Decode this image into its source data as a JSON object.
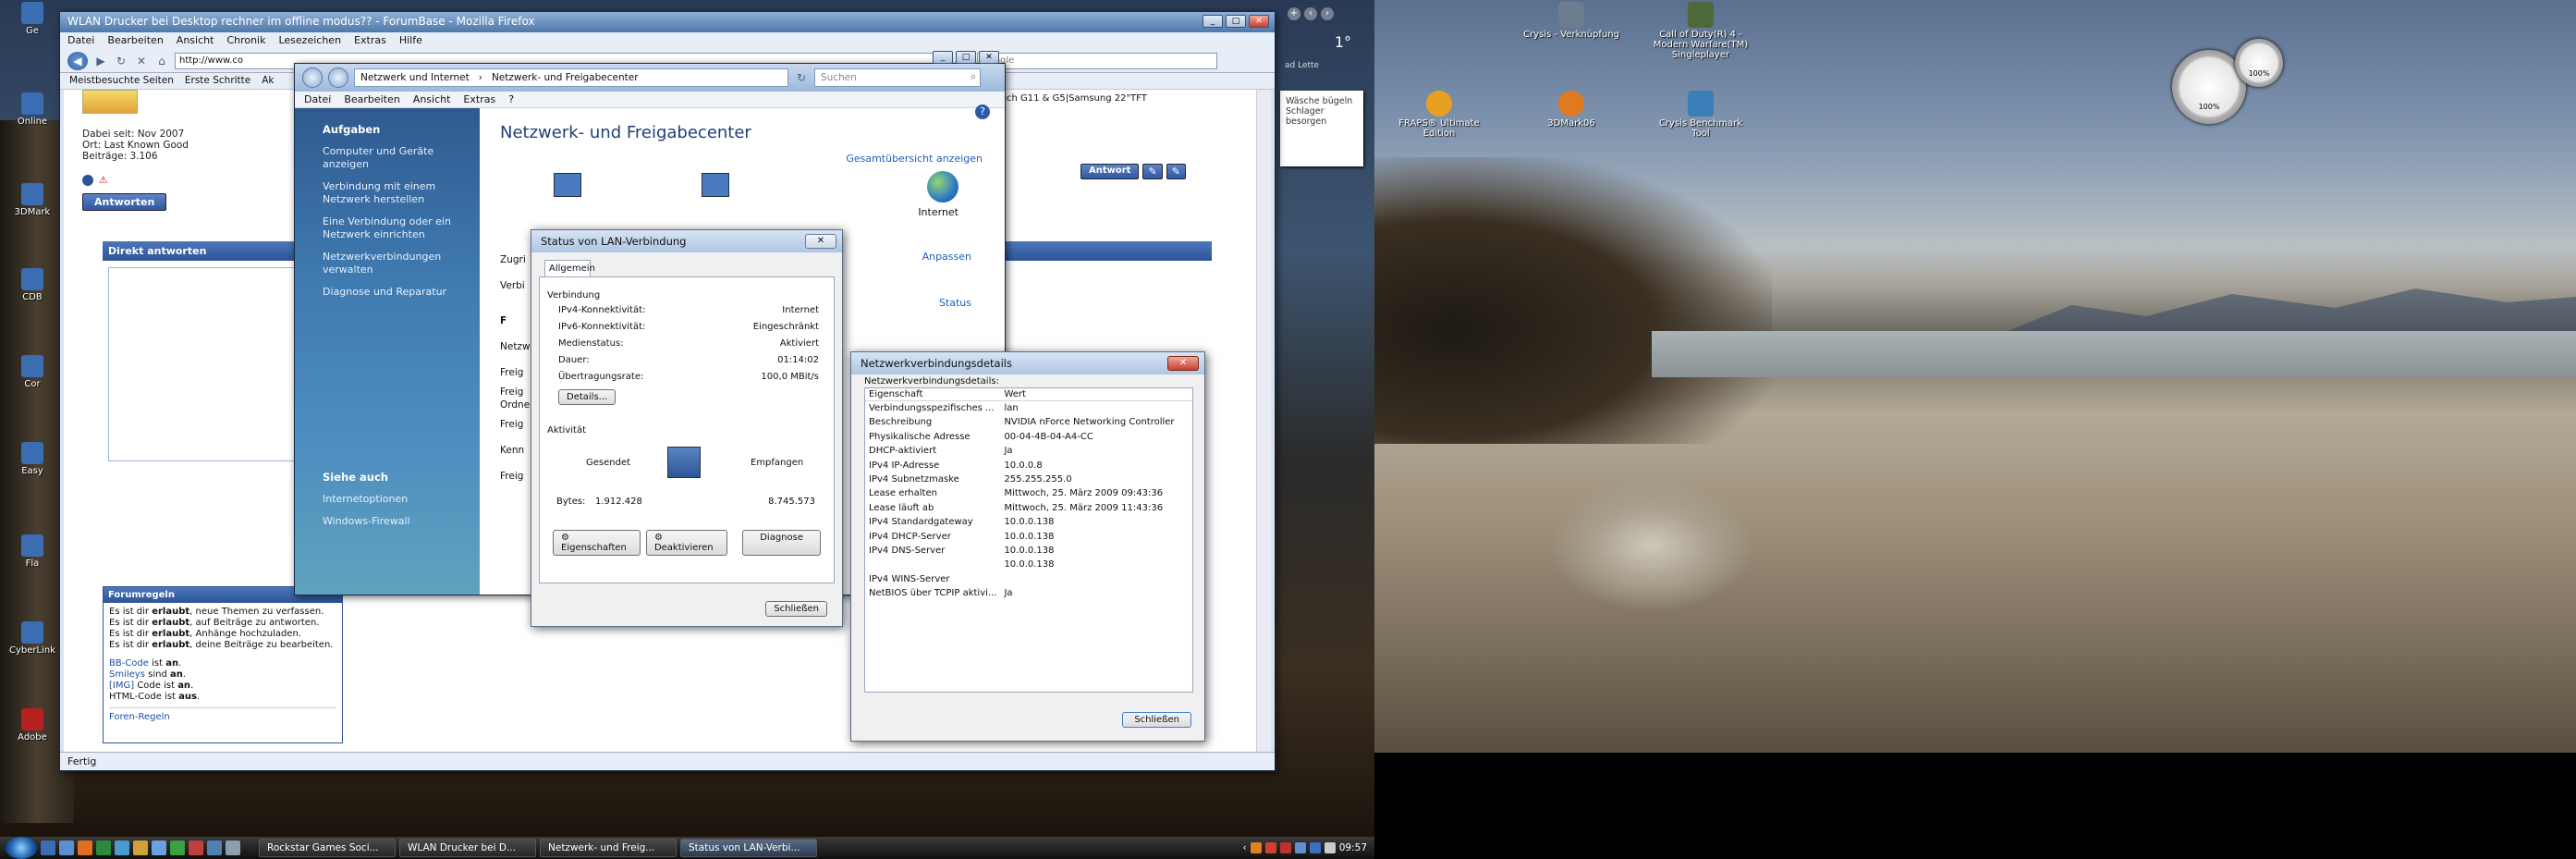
{
  "firefox": {
    "title": "WLAN Drucker bei Desktop rechner im offline modus?? - ForumBase - Mozilla Firefox",
    "menu": [
      "Datei",
      "Bearbeiten",
      "Ansicht",
      "Chronik",
      "Lesezeichen",
      "Extras",
      "Hilfe"
    ],
    "url": "http://www.co",
    "search_placeholder": "Google",
    "bookmarks": [
      "Meistbesuchte Seiten",
      "Erste Schritte",
      "Ak"
    ],
    "status": "Fertig",
    "forum": {
      "user_info": [
        "Dabei seit: Nov 2007",
        "Ort: Last Known Good",
        "Beiträge: 3.106"
      ],
      "answer_button": "Antworten",
      "reply_header": "Direkt antworten",
      "top_right_text": "em|Logitech G11 & G5|Samsung 22\"TFT",
      "answer_button2": "Antwort",
      "rules_header": "Forumregeln",
      "rules": [
        {
          "pre": "Es ist dir ",
          "bold": "erlaubt",
          "post": ", neue Themen zu verfassen."
        },
        {
          "pre": "Es ist dir ",
          "bold": "erlaubt",
          "post": ", auf Beiträge zu antworten."
        },
        {
          "pre": "Es ist dir ",
          "bold": "erlaubt",
          "post": ", Anhänge hochzuladen."
        },
        {
          "pre": "Es ist dir ",
          "bold": "erlaubt",
          "post": ", deine Beiträge zu bearbeiten."
        }
      ],
      "codes": [
        {
          "link": "BB-Code",
          "text": " ist ",
          "val": "an"
        },
        {
          "link": "Smileys",
          "text": " sind ",
          "val": "an"
        },
        {
          "link": "[IMG]",
          "text": " Code ist ",
          "val": "an"
        },
        {
          "link": "",
          "text": "HTML-Code ist ",
          "val": "aus"
        }
      ],
      "rules_link": "Foren-Regeln"
    }
  },
  "control_panel": {
    "address": [
      "Netzwerk und Internet",
      "Netzwerk- und Freigabecenter"
    ],
    "search_placeholder": "Suchen",
    "menu": [
      "Datei",
      "Bearbeiten",
      "Ansicht",
      "Extras",
      "?"
    ],
    "tasks_header": "Aufgaben",
    "tasks": [
      "Computer und Geräte anzeigen",
      "Verbindung mit einem Netzwerk herstellen",
      "Eine Verbindung oder ein Netzwerk einrichten",
      "Netzwerkverbindungen verwalten",
      "Diagnose und Reparatur"
    ],
    "see_also_header": "Siehe auch",
    "see_also": [
      "Internetoptionen",
      "Windows-Firewall"
    ],
    "title": "Netzwerk- und Freigabecenter",
    "overview_link": "Gesamtübersicht anzeigen",
    "internet_label": "Internet",
    "customize_link": "Anpassen",
    "status_link": "Status",
    "partial_labels": [
      "Zugri",
      "Verbi",
      "F",
      "Netzw",
      "Freig",
      "Freig",
      "Ordne",
      "Freig",
      "Kenn",
      "Freig"
    ]
  },
  "lan_status": {
    "title": "Status von LAN-Verbindung",
    "tab": "Allgemein",
    "connection_group": "Verbindung",
    "rows": [
      {
        "k": "IPv4-Konnektivität:",
        "v": "Internet"
      },
      {
        "k": "IPv6-Konnektivität:",
        "v": "Eingeschränkt"
      },
      {
        "k": "Medienstatus:",
        "v": "Aktiviert"
      },
      {
        "k": "Dauer:",
        "v": "01:14:02"
      },
      {
        "k": "Übertragungsrate:",
        "v": "100,0 MBit/s"
      }
    ],
    "details_button": "Details...",
    "activity_group": "Aktivität",
    "sent_label": "Gesendet",
    "received_label": "Empfangen",
    "bytes_label": "Bytes:",
    "bytes_sent": "1.912.428",
    "bytes_received": "8.745.573",
    "buttons": [
      "Eigenschaften",
      "Deaktivieren",
      "Diagnose"
    ],
    "close_button": "Schließen"
  },
  "details": {
    "title": "Netzwerkverbindungsdetails",
    "subtitle": "Netzwerkverbindungsdetails:",
    "col_property": "Eigenschaft",
    "col_value": "Wert",
    "rows": [
      {
        "k": "Verbindungsspezifisches ...",
        "v": "lan"
      },
      {
        "k": "Beschreibung",
        "v": "NVIDIA nForce Networking Controller"
      },
      {
        "k": "Physikalische Adresse",
        "v": "00-04-4B-04-A4-CC"
      },
      {
        "k": "DHCP-aktiviert",
        "v": "Ja"
      },
      {
        "k": "IPv4 IP-Adresse",
        "v": "10.0.0.8"
      },
      {
        "k": "IPv4 Subnetzmaske",
        "v": "255.255.255.0"
      },
      {
        "k": "Lease erhalten",
        "v": "Mittwoch, 25. März 2009 09:43:36"
      },
      {
        "k": "Lease läuft ab",
        "v": "Mittwoch, 25. März 2009 11:43:36"
      },
      {
        "k": "IPv4 Standardgateway",
        "v": "10.0.0.138"
      },
      {
        "k": "IPv4 DHCP-Server",
        "v": "10.0.0.138"
      },
      {
        "k": "IPv4 DNS-Server",
        "v": "10.0.0.138"
      },
      {
        "k": "",
        "v": "10.0.0.138"
      },
      {
        "k": "IPv4 WINS-Server",
        "v": ""
      },
      {
        "k": "NetBIOS über TCPIP aktivi...",
        "v": "Ja"
      }
    ],
    "close_button": "Schließen"
  },
  "desktop_right": {
    "icons": [
      {
        "label": "Crysis - Verknüpfung",
        "color": "#6b7d8f"
      },
      {
        "label": "Call of Duty(R) 4 - Modern Warfare(TM) Singleplayer",
        "color": "#4f6a3a"
      },
      {
        "label": "FRAPS® Ultimate Edition",
        "color": "#e8a020"
      },
      {
        "label": "3DMark06",
        "color": "#e07a20"
      },
      {
        "label": "Crysis Benchmark Tool",
        "color": "#3a7fb8"
      }
    ],
    "note": "Wäsche bügeln Schlager besorgen",
    "temperature": "1°",
    "clock_tail": "ad Lette",
    "gauge1": "100%",
    "gauge2": "100%"
  },
  "desktop_left_icons": [
    "Ge",
    "Online",
    "3DMark",
    "CDB",
    "Cor",
    "Easy",
    "Fla",
    "CyberLink",
    "Adobe"
  ],
  "taskbar": {
    "items": [
      "Rockstar Games Soci...",
      "WLAN Drucker bei D...",
      "Netzwerk- und Freig...",
      "Status von LAN-Verbi..."
    ],
    "active_index": 3,
    "time": "09:57"
  }
}
